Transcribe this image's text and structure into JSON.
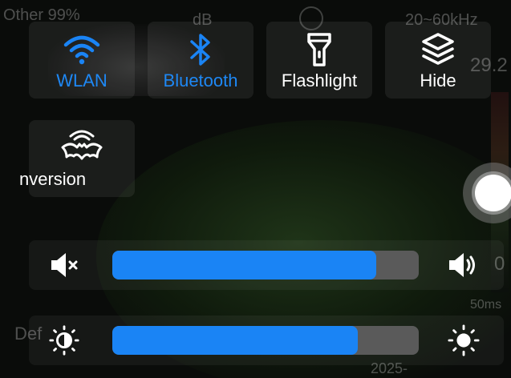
{
  "background": {
    "top_left": "Other 99%",
    "db_label": "dB",
    "freq_range": "20~60kHz",
    "right_value": "29.2",
    "edge_value": "0",
    "right_small": "50ms",
    "left_bottom": "Def",
    "bottom_date": "2025-"
  },
  "tiles": [
    {
      "label": "WLAN",
      "icon": "wifi-icon",
      "active": true
    },
    {
      "label": "Bluetooth",
      "icon": "bluetooth-icon",
      "active": true
    },
    {
      "label": "Flashlight",
      "icon": "flashlight-icon",
      "active": false
    },
    {
      "label": "Hide",
      "icon": "layers-icon",
      "active": false
    },
    {
      "label": "nversion",
      "icon": "bat-icon",
      "active": false
    }
  ],
  "volume": {
    "level": 0.86,
    "min_icon": "volume-mute-icon",
    "max_icon": "volume-high-icon"
  },
  "brightness": {
    "level": 0.8,
    "min_icon": "brightness-low-icon",
    "max_icon": "brightness-high-icon"
  },
  "colors": {
    "accent": "#1a84f5",
    "track": "#5a5a5a"
  }
}
